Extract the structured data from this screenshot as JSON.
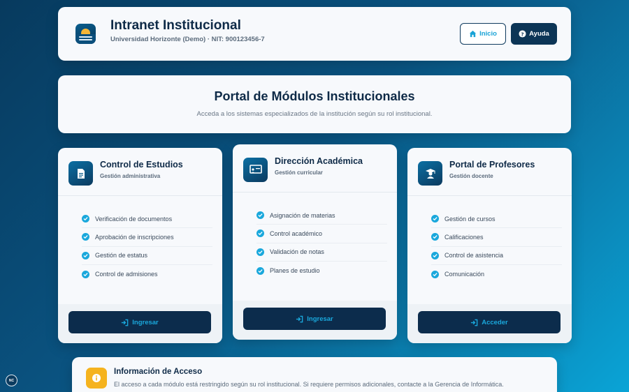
{
  "header": {
    "title": "Intranet Institucional",
    "subtitle": "Universidad Horizonte (Demo) · NIT: 900123456-7",
    "nav": [
      {
        "label": "Inicio",
        "icon": "home-icon"
      },
      {
        "label": "Ayuda",
        "icon": "help-icon"
      }
    ]
  },
  "portal": {
    "title": "Portal de Módulos Institucionales",
    "subtitle": "Acceda a los sistemas especializados de la institución según su rol institucional."
  },
  "modules": [
    {
      "title": "Control de Estudios",
      "subtitle": "Gestión administrativa",
      "icon": "document-icon",
      "items": [
        "Verificación de documentos",
        "Aprobación de inscripciones",
        "Gestión de estatus",
        "Control de admisiones"
      ],
      "button": "Ingresar"
    },
    {
      "title": "Dirección Académica",
      "subtitle": "Gestión curricular",
      "icon": "presentation-board-icon",
      "items": [
        "Asignación de materias",
        "Control académico",
        "Validación de notas",
        "Planes de estudio"
      ],
      "button": "Ingresar"
    },
    {
      "title": "Portal de Profesores",
      "subtitle": "Gestión docente",
      "icon": "teacher-icon",
      "items": [
        "Gestión de cursos",
        "Calificaciones",
        "Control de asistencia",
        "Comunicación"
      ],
      "button": "Acceder"
    }
  ],
  "info": {
    "title": "Información de Acceso",
    "text": "El acceso a cada módulo está restringido según su rol institucional. Si requiere permisos adicionales, contacte a la Gerencia de Informática.",
    "icon": "info-icon"
  },
  "badge": "NC",
  "colors": {
    "primary_dark": "#0c2c4c",
    "accent": "#1aa8dc",
    "warning": "#f5b31e"
  }
}
